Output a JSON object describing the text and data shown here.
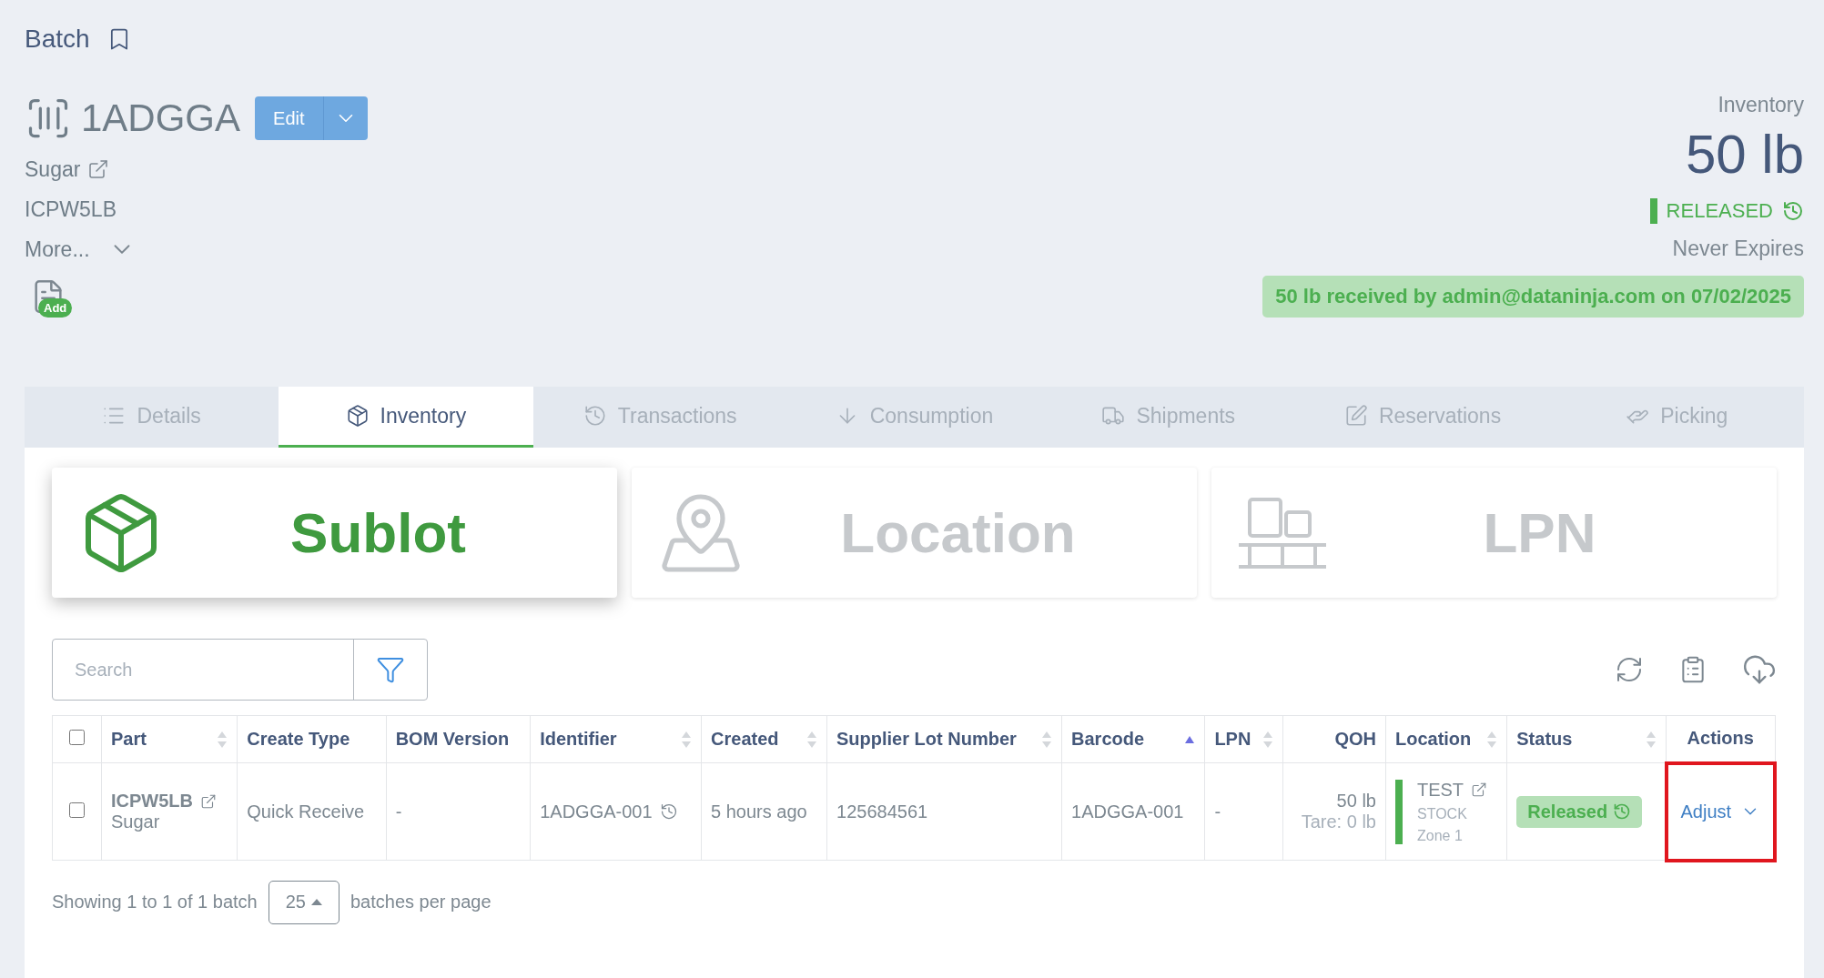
{
  "header": {
    "title": "Batch",
    "batch_code": "1ADGGA",
    "edit_button": "Edit",
    "part_name": "Sugar",
    "part_code": "ICPW5LB",
    "more": "More...",
    "add_badge": "Add"
  },
  "summary": {
    "label": "Inventory",
    "quantity": "50 lb",
    "status": "RELEASED",
    "expiry": "Never Expires",
    "received_note": "50 lb received by admin@dataninja.com on 07/02/2025"
  },
  "tabs": [
    {
      "label": "Details",
      "selected": false
    },
    {
      "label": "Inventory",
      "selected": true
    },
    {
      "label": "Transactions",
      "selected": false
    },
    {
      "label": "Consumption",
      "selected": false
    },
    {
      "label": "Shipments",
      "selected": false
    },
    {
      "label": "Reservations",
      "selected": false
    },
    {
      "label": "Picking",
      "selected": false
    }
  ],
  "view_cards": [
    {
      "label": "Sublot",
      "selected": true
    },
    {
      "label": "Location",
      "selected": false
    },
    {
      "label": "LPN",
      "selected": false
    }
  ],
  "search": {
    "placeholder": "Search"
  },
  "table": {
    "select_all_checked": false,
    "columns": [
      {
        "label": "Part",
        "sortable": true,
        "sorted": false
      },
      {
        "label": "Create Type",
        "sortable": false,
        "sorted": false
      },
      {
        "label": "BOM Version",
        "sortable": false,
        "sorted": false
      },
      {
        "label": "Identifier",
        "sortable": true,
        "sorted": false
      },
      {
        "label": "Created",
        "sortable": true,
        "sorted": false
      },
      {
        "label": "Supplier Lot Number",
        "sortable": true,
        "sorted": false
      },
      {
        "label": "Barcode",
        "sortable": true,
        "sorted": true
      },
      {
        "label": "LPN",
        "sortable": true,
        "sorted": false
      },
      {
        "label": "QOH",
        "sortable": false,
        "sorted": false
      },
      {
        "label": "Location",
        "sortable": true,
        "sorted": false
      },
      {
        "label": "Status",
        "sortable": true,
        "sorted": false
      },
      {
        "label": "Actions",
        "sortable": false,
        "sorted": false
      }
    ],
    "rows": [
      {
        "checked": false,
        "part_code": "ICPW5LB",
        "part_name": "Sugar",
        "create_type": "Quick Receive",
        "bom_version": "-",
        "identifier": "1ADGGA-001",
        "created": "5 hours ago",
        "supplier_lot": "125684561",
        "barcode": "1ADGGA-001",
        "lpn": "-",
        "qoh": "50 lb",
        "tare": "Tare: 0 lb",
        "location": "TEST",
        "location_type": "STOCK",
        "zone": "Zone 1",
        "status": "Released",
        "action": "Adjust",
        "highlighted": true
      }
    ]
  },
  "footer": {
    "showing": "Showing 1 to 1 of 1 batch",
    "page_size": "25",
    "per_page": "batches per page"
  }
}
